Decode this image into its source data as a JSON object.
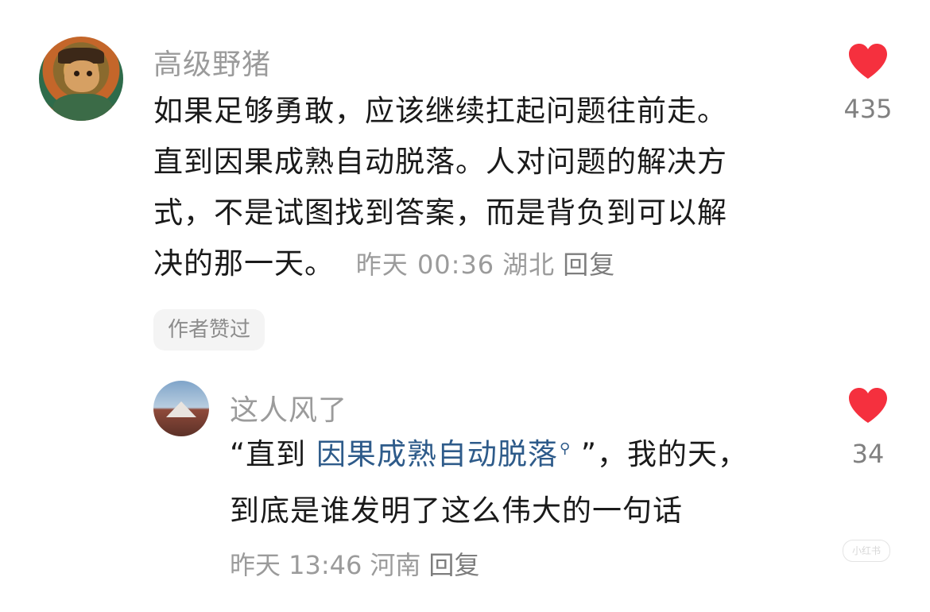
{
  "comment": {
    "username": "高级野猪",
    "text_lines": [
      "如果足够勇敢，应该继续扛起问题往前走。",
      "直到因果成熟自动脱落。人对问题的解决方",
      "式，不是试图找到答案，而是背负到可以解",
      "决的那一天。"
    ],
    "time": "昨天 00:36",
    "location": "湖北",
    "reply_label": "回复",
    "badge": "作者赞过",
    "likes": "435",
    "heart_color": "#f5303e"
  },
  "reply": {
    "username": "这人风了",
    "open_quote": "“直到 ",
    "link_text": "因果成熟自动脱落",
    "close_text": " ”，我的天，",
    "line2": "到底是谁发明了这么伟大的一句话",
    "time": "昨天 13:46",
    "location": "河南",
    "reply_label": "回复",
    "likes": "34",
    "link_color": "#2e5b8a"
  },
  "watermark": "小红书"
}
